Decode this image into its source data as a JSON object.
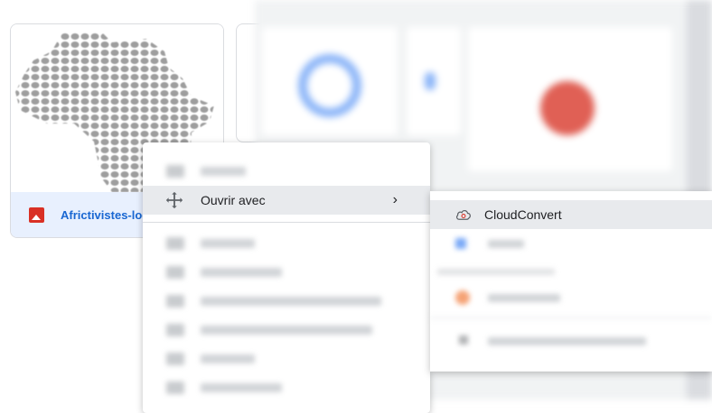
{
  "file_card": {
    "name": "Africtivistes-log",
    "type_icon": "image-icon"
  },
  "context_menu": {
    "open_with_label": "Ouvrir avec",
    "open_with_icon": "move-icon",
    "submenu_arrow": "›"
  },
  "submenu": {
    "cloudconvert_label": "CloudConvert",
    "cloudconvert_icon": "cloud-icon"
  },
  "colors": {
    "selected_card_bg": "#e8f0fe",
    "file_name_blue": "#1967d2",
    "image_icon_red": "#d93025",
    "hover_bg": "#e8eaed"
  }
}
